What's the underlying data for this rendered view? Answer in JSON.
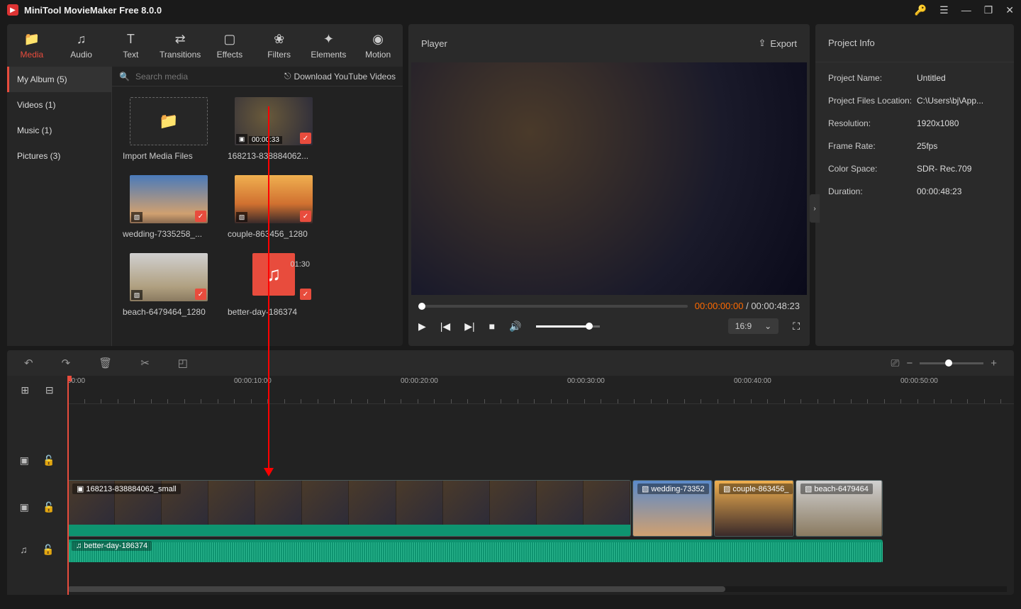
{
  "app_title": "MiniTool MovieMaker Free 8.0.0",
  "top_tabs": [
    {
      "label": "Media",
      "icon": "📁"
    },
    {
      "label": "Audio",
      "icon": "♫"
    },
    {
      "label": "Text",
      "icon": "T"
    },
    {
      "label": "Transitions",
      "icon": "⇄"
    },
    {
      "label": "Effects",
      "icon": "▢"
    },
    {
      "label": "Filters",
      "icon": "❀"
    },
    {
      "label": "Elements",
      "icon": "✦"
    },
    {
      "label": "Motion",
      "icon": "◉"
    }
  ],
  "sidebar": {
    "items": [
      {
        "label": "My Album (5)"
      },
      {
        "label": "Videos (1)"
      },
      {
        "label": "Music (1)"
      },
      {
        "label": "Pictures (3)"
      }
    ]
  },
  "search": {
    "placeholder": "Search media"
  },
  "download_link": "Download YouTube Videos",
  "media": {
    "import_label": "Import Media Files",
    "items": [
      {
        "name": "168213-838884062...",
        "duration": "00:00:33",
        "type": "video"
      },
      {
        "name": "wedding-7335258_...",
        "type": "image"
      },
      {
        "name": "couple-863456_1280",
        "type": "image"
      },
      {
        "name": "beach-6479464_1280",
        "type": "image"
      },
      {
        "name": "better-day-186374",
        "duration": "01:30",
        "type": "audio"
      }
    ]
  },
  "player": {
    "title": "Player",
    "export": "Export",
    "current_time": "00:00:00:00",
    "total_time": "00:00:48:23",
    "aspect": "16:9"
  },
  "project_info": {
    "title": "Project Info",
    "rows": [
      {
        "k": "Project Name:",
        "v": "Untitled"
      },
      {
        "k": "Project Files Location:",
        "v": "C:\\Users\\bj\\App..."
      },
      {
        "k": "Resolution:",
        "v": "1920x1080"
      },
      {
        "k": "Frame Rate:",
        "v": "25fps"
      },
      {
        "k": "Color Space:",
        "v": "SDR- Rec.709"
      },
      {
        "k": "Duration:",
        "v": "00:00:48:23"
      }
    ]
  },
  "ruler": [
    {
      "label": "00:00",
      "pos": 0
    },
    {
      "label": "00:00:10:00",
      "pos": 235
    },
    {
      "label": "00:00:20:00",
      "pos": 470
    },
    {
      "label": "00:00:30:00",
      "pos": 705
    },
    {
      "label": "00:00:40:00",
      "pos": 940
    },
    {
      "label": "00:00:50:00",
      "pos": 1175
    }
  ],
  "clips": {
    "video_main": "168213-838884062_small",
    "img1": "wedding-73352",
    "img2": "couple-863456_",
    "img3": "beach-6479464",
    "audio": "better-day-186374"
  }
}
